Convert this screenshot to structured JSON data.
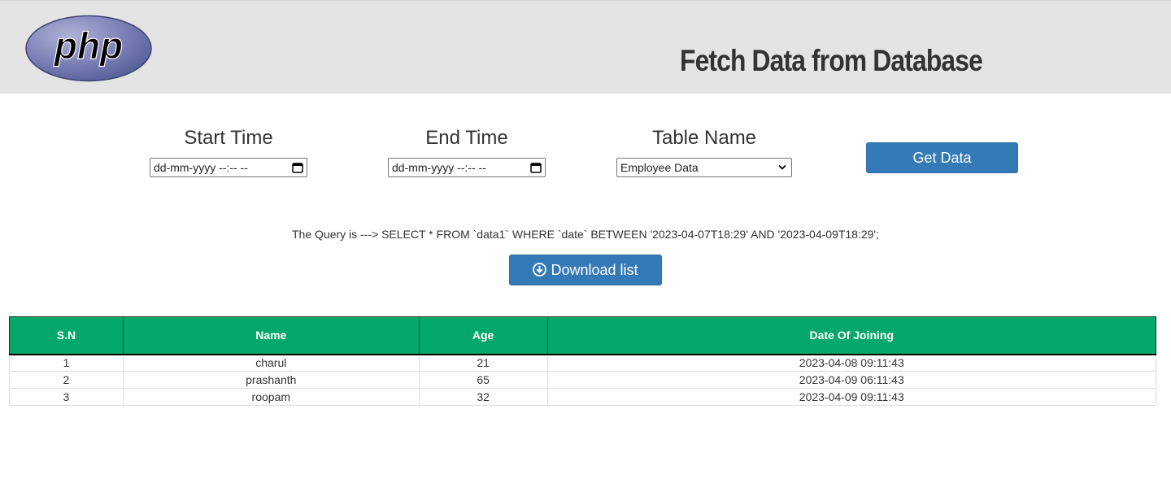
{
  "header": {
    "logo_text": "php",
    "title": "Fetch Data from Database"
  },
  "filters": {
    "start_time": {
      "label": "Start Time",
      "value": "dd-mm-yyyy --:-- --"
    },
    "end_time": {
      "label": "End Time",
      "value": "dd-mm-yyyy --:-- --"
    },
    "table_name": {
      "label": "Table Name",
      "selected": "Employee Data"
    },
    "get_data_label": "Get Data"
  },
  "query": {
    "text": "The Query is ---> SELECT * FROM `data1` WHERE `date` BETWEEN '2023-04-07T18:29' AND '2023-04-09T18:29';"
  },
  "download": {
    "label": "Download list",
    "icon": "download-circle-icon"
  },
  "table": {
    "columns": [
      "S.N",
      "Name",
      "Age",
      "Date Of Joining"
    ],
    "rows": [
      [
        "1",
        "charul",
        "21",
        "2023-04-08 09:11:43"
      ],
      [
        "2",
        "prashanth",
        "65",
        "2023-04-09 06:11:43"
      ],
      [
        "3",
        "roopam",
        "32",
        "2023-04-09 09:11:43"
      ]
    ]
  },
  "colors": {
    "header_bg": "#e4e4e4",
    "button_blue": "#337ab7",
    "table_header_green": "#05a86c",
    "php_logo_purple": "#777bb3"
  }
}
